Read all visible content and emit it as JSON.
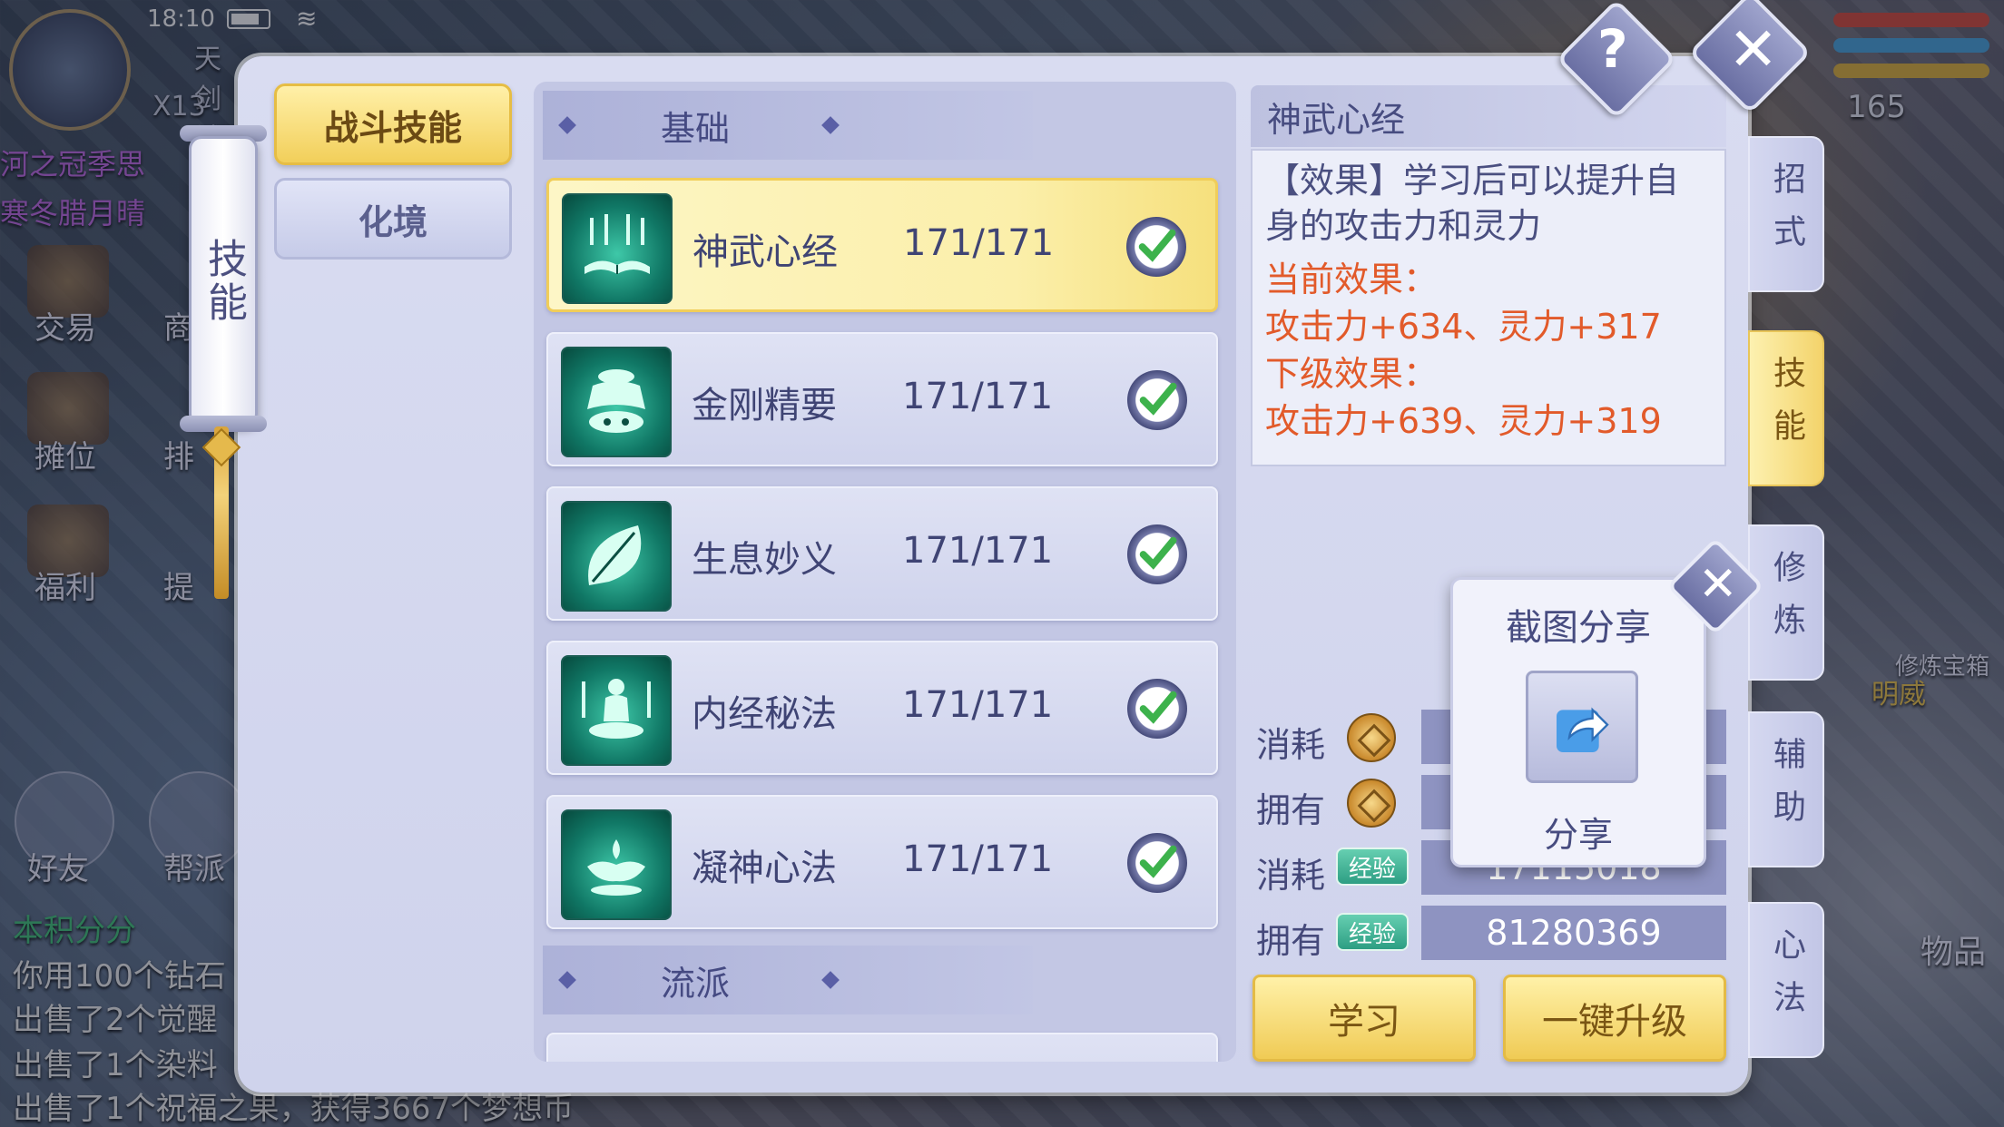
{
  "status_bar": {
    "time": "18:10"
  },
  "background_hud": {
    "left_labels": [
      "交易",
      "摊位",
      "福利"
    ],
    "left_labels_partial": [
      "商",
      "排",
      "提"
    ],
    "friend": "好友",
    "guild": "帮派",
    "purple_text_1": "河之冠季思",
    "purple_text_2": "寒冬腊月晴",
    "server_text": "天剑城",
    "x_count": "X13",
    "level": "165",
    "chat": [
      {
        "text": "本积分分",
        "color": "green"
      },
      {
        "text": "你用100个钻石",
        "color": "white"
      },
      {
        "text": "出售了2个觉醒",
        "color": "white"
      },
      {
        "text": "出售了1个染料",
        "color": "white"
      },
      {
        "text": "出售了1个祝福之果，获得3667个梦想币",
        "color": "white"
      }
    ],
    "right_labels": [
      "物品",
      "修炼宝箱",
      "明威"
    ]
  },
  "scroll_title": "技能",
  "category_tabs": [
    {
      "label": "战斗技能",
      "active": true
    },
    {
      "label": "化境",
      "active": false
    }
  ],
  "sections": {
    "basic": "基础",
    "school": "流派"
  },
  "skills": [
    {
      "name": "神武心经",
      "level": "171/171",
      "icon": "book-icon",
      "selected": true,
      "maxed": true
    },
    {
      "name": "金刚精要",
      "level": "171/171",
      "icon": "bell-icon",
      "selected": false,
      "maxed": true
    },
    {
      "name": "生息妙义",
      "level": "171/171",
      "icon": "leaf-icon",
      "selected": false,
      "maxed": true
    },
    {
      "name": "内经秘法",
      "level": "171/171",
      "icon": "meditate-icon",
      "selected": false,
      "maxed": true
    },
    {
      "name": "凝神心法",
      "level": "171/171",
      "icon": "lotus-icon",
      "selected": false,
      "maxed": true
    }
  ],
  "detail": {
    "title": "神武心经",
    "effect_line1": "【效果】学习后可以提升自",
    "effect_line2": "身的攻击力和灵力",
    "current_label": "当前效果：",
    "current_value": "攻击力+634、灵力+317",
    "next_label": "下级效果：",
    "next_value": "攻击力+639、灵力+319"
  },
  "resources": {
    "cost_label": "消耗",
    "own_label": "拥有",
    "exp_badge": "经验",
    "exp_cost": "17115018",
    "exp_own": "81280369"
  },
  "buttons": {
    "learn": "学习",
    "upgrade_all": "一键升级"
  },
  "side_tabs": [
    {
      "label": "招式",
      "active": false
    },
    {
      "label": "技能",
      "active": true
    },
    {
      "label": "修炼",
      "active": false
    },
    {
      "label": "辅助",
      "active": false
    },
    {
      "label": "心法",
      "active": false
    }
  ],
  "share_popup": {
    "title": "截图分享",
    "label": "分享"
  },
  "colors": {
    "accent_gold": "#f2cf5a",
    "effect_red": "#e25a2a",
    "exp_green": "#2d9e83"
  }
}
